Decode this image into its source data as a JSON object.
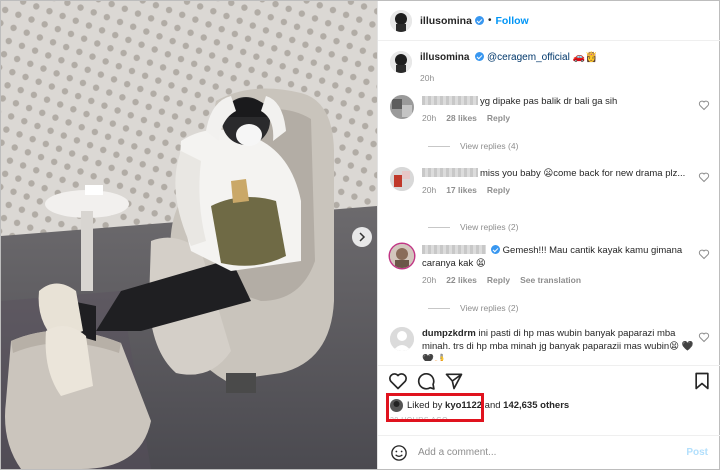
{
  "post": {
    "username": "illusomina",
    "follow_label": "Follow",
    "dot": "•"
  },
  "caption": {
    "username": "illusomina",
    "mention": "@ceragem_official",
    "emoji": "🚗👸",
    "time": "20h"
  },
  "comments": [
    {
      "text": "yg dipake pas balik dr bali ga sih",
      "time": "20h",
      "likes": "28 likes",
      "reply": "Reply",
      "view_replies": "View replies (4)"
    },
    {
      "text": "miss you baby 😦come back for new drama plz...",
      "time": "20h",
      "likes": "17 likes",
      "reply": "Reply",
      "view_replies": "View replies (2)"
    },
    {
      "text": "Gemesh!!! Mau cantik kayak kamu gimana caranya kak 😫",
      "time": "20h",
      "likes": "22 likes",
      "reply": "Reply",
      "translation": "See translation",
      "view_replies": "View replies (2)"
    },
    {
      "username": "dumpzkdrm",
      "text": "ini pasti di hp mas wubin banyak paparazi mba minah. trs di hp mba minah jg banyak paparazii mas wubin😫 🖤🖤🤳"
    }
  ],
  "likes": {
    "prefix": "Liked by",
    "user": "kyo1122",
    "middle": "and",
    "count": "142,635 others"
  },
  "time_ago": "20 HOURS AGO",
  "add_comment": {
    "placeholder": "Add a comment...",
    "post_label": "Post"
  },
  "colors": {
    "accent": "#0095f6",
    "highlight": "#e0131e",
    "verified": "#3897f0"
  }
}
